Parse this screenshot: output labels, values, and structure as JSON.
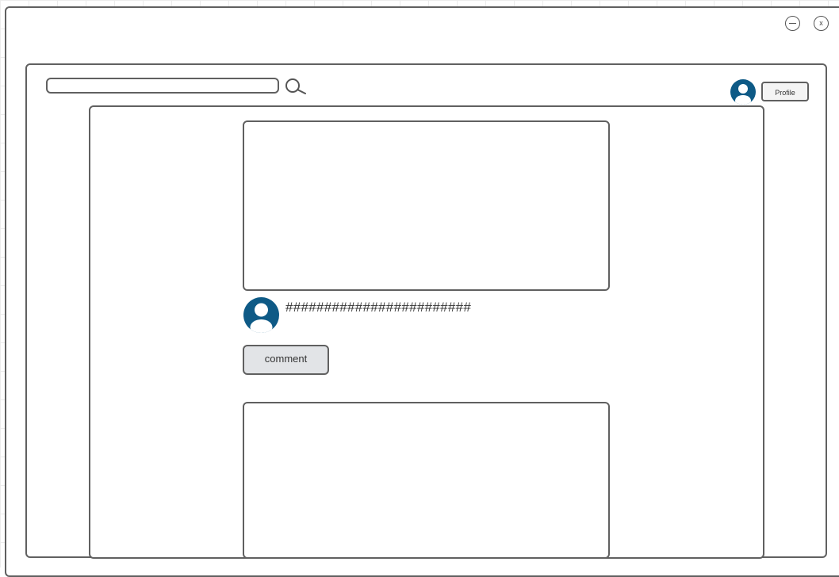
{
  "window": {
    "controls": {
      "minimize_icon": "minimize-circle-icon",
      "close_label": "x"
    }
  },
  "header": {
    "search": {
      "placeholder": "",
      "value": "",
      "icon": "search-icon"
    },
    "user": {
      "avatar_icon": "user-avatar-icon",
      "profile_label": "Profile"
    }
  },
  "feed": {
    "posts": [
      {
        "author_avatar_icon": "user-avatar-icon",
        "text": "########################",
        "comment_label": "comment"
      }
    ]
  },
  "colors": {
    "outline": "#606060",
    "avatar": "#0e5a86",
    "button_fill": "#e2e4e7"
  }
}
